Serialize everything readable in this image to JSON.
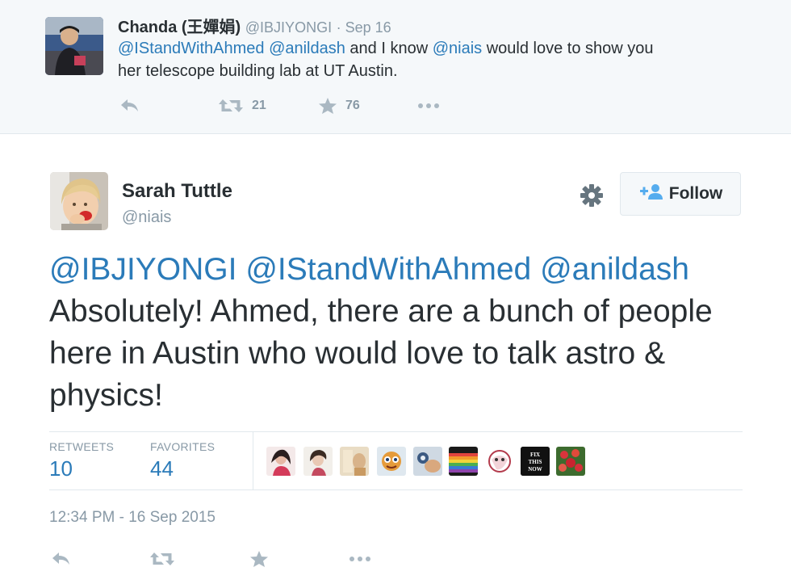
{
  "parent_tweet": {
    "name": "Chanda (王嬋娟)",
    "handle": "@IBJIYONGI",
    "time": "· Sep 16",
    "mention1": "@IStandWithAhmed",
    "mention2": "@anildash",
    "text_mid": " and I know ",
    "mention3": "@niais",
    "text_end1": " would love to show you",
    "text_end2": "her telescope building lab at UT Austin.",
    "retweet_count": "21",
    "favorite_count": "76"
  },
  "tweet": {
    "name": "Sarah Tuttle",
    "handle": "@niais",
    "follow_label": "Follow",
    "mention1": "@IBJIYONGI",
    "mention2": "@IStandWithAhmed",
    "mention3": "@anildash",
    "text_body": " Absolutely! Ahmed, there are a bunch of people here in Austin who would love to talk astro & physics!",
    "stats": {
      "retweets_label": "RETWEETS",
      "retweets_value": "10",
      "favorites_label": "FAVORITES",
      "favorites_value": "44"
    },
    "favoriter_thumb_text": "FIX THIS NOW",
    "timestamp": "12:34 PM - 16 Sep 2015"
  },
  "colors": {
    "link": "#2b7bb9",
    "muted": "#8899a6",
    "text": "#292f33",
    "parent_bg": "#f5f8fa",
    "border": "#e1e8ed"
  },
  "icons": [
    "reply-icon",
    "retweet-icon",
    "star-icon",
    "more-icon",
    "gear-icon",
    "follow-person-icon"
  ]
}
